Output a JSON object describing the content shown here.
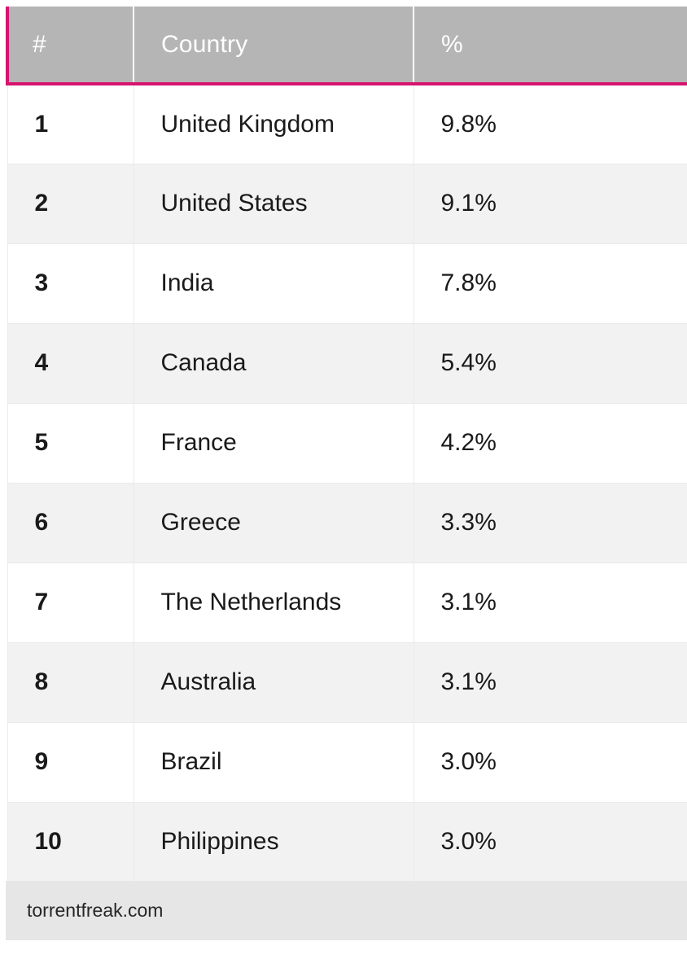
{
  "table": {
    "columns": [
      {
        "key": "rank",
        "label": "#"
      },
      {
        "key": "country",
        "label": "Country"
      },
      {
        "key": "percent",
        "label": "%"
      }
    ],
    "rows": [
      {
        "rank": "1",
        "country": "United Kingdom",
        "percent": "9.8%"
      },
      {
        "rank": "2",
        "country": "United States",
        "percent": "9.1%"
      },
      {
        "rank": "3",
        "country": "India",
        "percent": "7.8%"
      },
      {
        "rank": "4",
        "country": "Canada",
        "percent": "5.4%"
      },
      {
        "rank": "5",
        "country": "France",
        "percent": "4.2%"
      },
      {
        "rank": "6",
        "country": "Greece",
        "percent": "3.3%"
      },
      {
        "rank": "7",
        "country": "The Netherlands",
        "percent": "3.1%"
      },
      {
        "rank": "8",
        "country": "Australia",
        "percent": "3.1%"
      },
      {
        "rank": "9",
        "country": "Brazil",
        "percent": "3.0%"
      },
      {
        "rank": "10",
        "country": "Philippines",
        "percent": "3.0%"
      }
    ]
  },
  "source": {
    "label": "torrentfreak.com"
  },
  "chart_data": {
    "type": "table",
    "title": "",
    "columns": [
      "#",
      "Country",
      "%"
    ],
    "categories": [
      "United Kingdom",
      "United States",
      "India",
      "Canada",
      "France",
      "Greece",
      "The Netherlands",
      "Australia",
      "Brazil",
      "Philippines"
    ],
    "values": [
      9.8,
      9.1,
      7.8,
      5.4,
      4.2,
      3.3,
      3.1,
      3.1,
      3.0,
      3.0
    ],
    "ranks": [
      1,
      2,
      3,
      4,
      5,
      6,
      7,
      8,
      9,
      10
    ],
    "value_labels": [
      "9.8%",
      "9.1%",
      "7.8%",
      "5.4%",
      "4.2%",
      "3.3%",
      "3.1%",
      "3.1%",
      "3.0%",
      "3.0%"
    ],
    "xlabel": "Country",
    "ylabel": "%",
    "unit": "percent",
    "source": "torrentfreak.com"
  },
  "colors": {
    "header_background": "#b5b5b5",
    "header_text": "#ffffff",
    "accent": "#d6136e",
    "row_odd": "#ffffff",
    "row_even": "#f2f2f2",
    "footer_background": "#e6e6e6",
    "body_text": "#1a1a1a"
  }
}
